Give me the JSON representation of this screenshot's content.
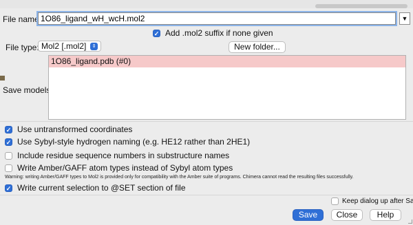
{
  "file_name": {
    "label": "File name:",
    "value": "1O86_ligand_wH_wcH.mol2"
  },
  "add_suffix": {
    "label": "Add .mol2 suffix if none given",
    "checked": true
  },
  "file_type": {
    "label": "File type:",
    "value": "Mol2 [.mol2]"
  },
  "new_folder": {
    "label": "New folder..."
  },
  "models": {
    "label": "Save models:",
    "items": [
      "1O86_ligand.pdb (#0)"
    ]
  },
  "options": [
    {
      "label": "Use untransformed coordinates",
      "checked": true
    },
    {
      "label": "Use Sybyl-style hydrogen naming (e.g. HE12 rather than 2HE1)",
      "checked": true
    },
    {
      "label": "Include residue sequence numbers in substructure names",
      "checked": false
    },
    {
      "label": "Write Amber/GAFF atom types instead of Sybyl atom types",
      "checked": false
    }
  ],
  "warning": "Warning: writing Amber/GAFF types to Mol2 is provided only for compatibility with the Amber suite of programs. Chimera cannot read the resulting files successfully.",
  "write_selection": {
    "label": "Write current selection to @SET section of file",
    "checked": true
  },
  "keep_dialog": {
    "label": "Keep dialog up after Save",
    "checked": false
  },
  "buttons": {
    "save": "Save",
    "close": "Close",
    "help": "Help"
  },
  "colors": {
    "accent": "#2f6fd6",
    "selected_row": "#f6c9c9"
  }
}
